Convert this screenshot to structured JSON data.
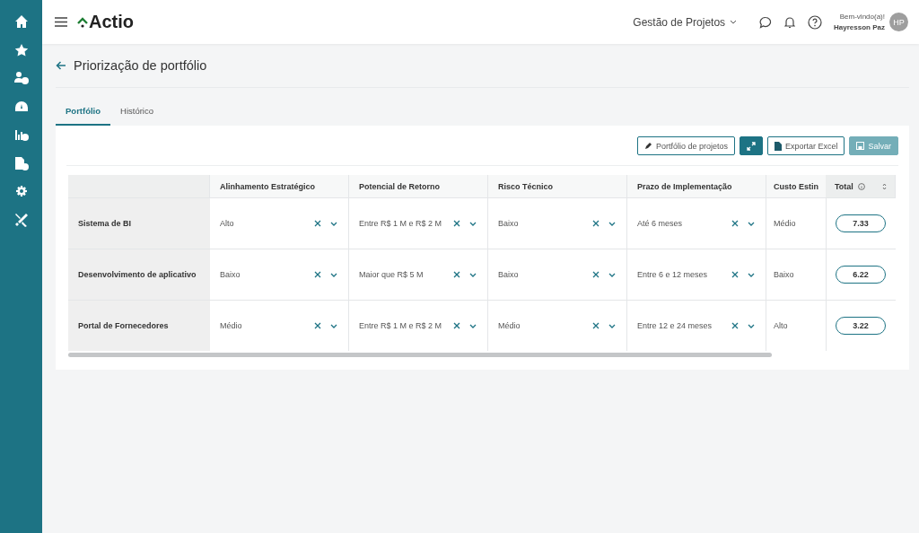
{
  "header": {
    "logo": "Actio",
    "module": "Gestão de Projetos",
    "greeting": "Bem-vindo(a)!",
    "user": "Hayresson Paz",
    "avatar": "HP"
  },
  "sidebar": {
    "items": [
      {
        "kind": "home"
      },
      {
        "kind": "star"
      },
      {
        "kind": "users"
      },
      {
        "kind": "gauge"
      },
      {
        "kind": "chart"
      },
      {
        "kind": "doc"
      },
      {
        "kind": "gear"
      },
      {
        "kind": "tools"
      }
    ]
  },
  "page": {
    "title": "Priorização de portfólio"
  },
  "tabs": [
    {
      "label": "Portfólio",
      "selected": true
    },
    {
      "label": "Histórico",
      "selected": false
    }
  ],
  "toolbar": {
    "buttons": [
      {
        "kind": "edit",
        "label": "Portfólio de projetos"
      },
      {
        "kind": "expand"
      },
      {
        "kind": "excel",
        "label": "Exportar Excel"
      },
      {
        "kind": "save",
        "label": "Salvar",
        "disabled": true
      }
    ]
  },
  "table": {
    "columns": [
      "Alinhamento Estratégico",
      "Potencial de Retorno",
      "Risco Técnico",
      "Prazo de Implementação",
      "Custo Estin"
    ],
    "total_column": "Total",
    "rows": [
      {
        "name": "Sistema de BI",
        "cells": [
          "Alto",
          "Entre R$ 1 M e R$ 2 M",
          "Baixo",
          "Até 6 meses"
        ],
        "cost": "Médio",
        "total": "7.33"
      },
      {
        "name": "Desenvolvimento de aplicativo",
        "cells": [
          "Baixo",
          "Maior que R$ 5 M",
          "Baixo",
          "Entre 6 e 12 meses"
        ],
        "cost": "Baixo",
        "total": "6.22"
      },
      {
        "name": "Portal de Fornecedores",
        "cells": [
          "Médio",
          "Entre R$ 1 M e R$ 2 M",
          "Médio",
          "Entre 12 e 24 meses"
        ],
        "cost": "Alto",
        "total": "3.22"
      }
    ]
  }
}
